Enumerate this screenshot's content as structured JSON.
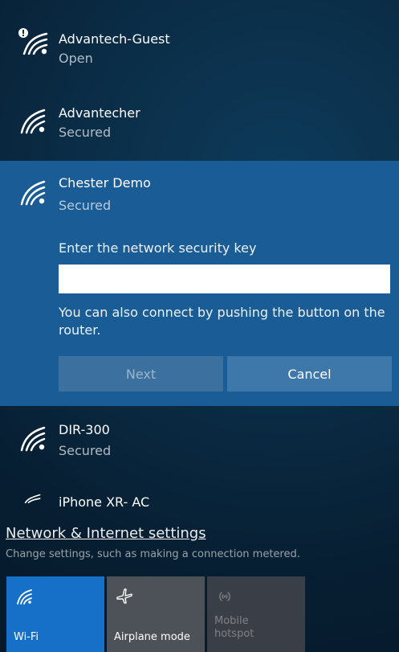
{
  "networks": [
    {
      "name": "Advantech-Guest",
      "status": "Open"
    },
    {
      "name": "Advantecher",
      "status": "Secured"
    },
    {
      "name": "Chester Demo",
      "status": "Secured",
      "connect_panel": {
        "prompt": "Enter the network security key",
        "input_value": "",
        "router_note": "You can also connect by pushing the button on the router.",
        "next_label": "Next",
        "cancel_label": "Cancel"
      }
    },
    {
      "name": "DIR-300",
      "status": "Secured"
    },
    {
      "name": "iPhone XR- AC",
      "status": ""
    }
  ],
  "settings": {
    "link": "Network & Internet settings",
    "description": "Change settings, such as making a connection metered."
  },
  "quick_actions": [
    {
      "label": "Wi-Fi",
      "icon": "wifi-icon",
      "active": true
    },
    {
      "label": "Airplane mode",
      "icon": "airplane-icon",
      "active": false
    },
    {
      "label": "Mobile hotspot",
      "icon": "mobile-hotspot-icon",
      "active": false,
      "disabled": true
    }
  ],
  "colors": {
    "selected_network_bg": "#1a5c95",
    "wifi_tile_active": "#1670c8",
    "tile_inactive": "#4d5158",
    "tile_disabled": "#3a3f47",
    "text": "#ffffff"
  }
}
